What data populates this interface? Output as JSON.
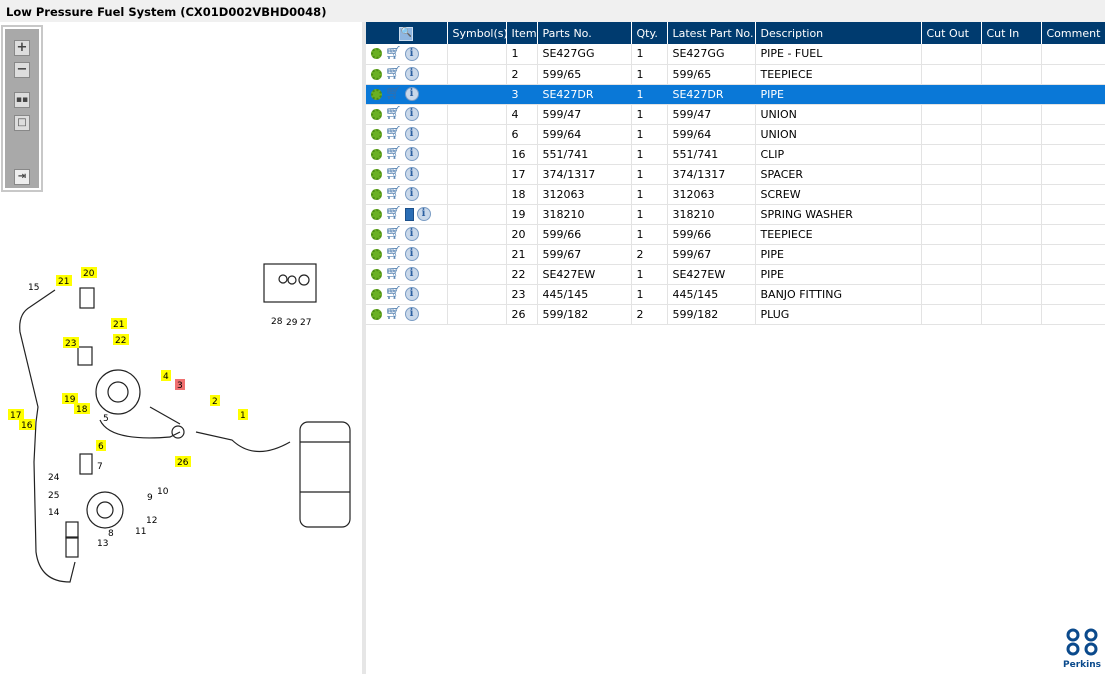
{
  "title": "Low Pressure Fuel System (CX01D002VBHD0048)",
  "toolbar": [
    "zoom-in",
    "zoom-out",
    "fit-all",
    "actual-size",
    "toggle-panel"
  ],
  "table": {
    "headers": [
      "",
      "Symbol(s)",
      "Item",
      "Parts No.",
      "Qty.",
      "Latest Part No.",
      "Description",
      "Cut Out",
      "Cut In",
      "Comment"
    ],
    "rows": [
      {
        "item": "1",
        "part": "SE427GG",
        "qty": "1",
        "latest": "SE427GG",
        "desc": "PIPE - FUEL"
      },
      {
        "item": "2",
        "part": "599/65",
        "qty": "1",
        "latest": "599/65",
        "desc": "TEEPIECE"
      },
      {
        "item": "3",
        "part": "SE427DR",
        "qty": "1",
        "latest": "SE427DR",
        "desc": "PIPE",
        "selected": true
      },
      {
        "item": "4",
        "part": "599/47",
        "qty": "1",
        "latest": "599/47",
        "desc": "UNION"
      },
      {
        "item": "6",
        "part": "599/64",
        "qty": "1",
        "latest": "599/64",
        "desc": "UNION"
      },
      {
        "item": "16",
        "part": "551/741",
        "qty": "1",
        "latest": "551/741",
        "desc": "CLIP"
      },
      {
        "item": "17",
        "part": "374/1317",
        "qty": "1",
        "latest": "374/1317",
        "desc": "SPACER"
      },
      {
        "item": "18",
        "part": "312063",
        "qty": "1",
        "latest": "312063",
        "desc": "SCREW"
      },
      {
        "item": "19",
        "part": "318210",
        "qty": "1",
        "latest": "318210",
        "desc": "SPRING WASHER",
        "book": true
      },
      {
        "item": "20",
        "part": "599/66",
        "qty": "1",
        "latest": "599/66",
        "desc": "TEEPIECE"
      },
      {
        "item": "21",
        "part": "599/67",
        "qty": "2",
        "latest": "599/67",
        "desc": "PIPE"
      },
      {
        "item": "22",
        "part": "SE427EW",
        "qty": "1",
        "latest": "SE427EW",
        "desc": "PIPE"
      },
      {
        "item": "23",
        "part": "445/145",
        "qty": "1",
        "latest": "445/145",
        "desc": "BANJO FITTING"
      },
      {
        "item": "26",
        "part": "599/182",
        "qty": "2",
        "latest": "599/182",
        "desc": "PLUG"
      }
    ]
  },
  "diagram_labels": [
    {
      "t": "15",
      "h": ""
    },
    {
      "t": "21",
      "h": "y"
    },
    {
      "t": "20",
      "h": "y"
    },
    {
      "t": "21",
      "h": "y"
    },
    {
      "t": "22",
      "h": "y"
    },
    {
      "t": "23",
      "h": "y"
    },
    {
      "t": "4",
      "h": "y"
    },
    {
      "t": "3",
      "h": "r"
    },
    {
      "t": "2",
      "h": "y"
    },
    {
      "t": "1",
      "h": "y"
    },
    {
      "t": "19",
      "h": "y"
    },
    {
      "t": "18",
      "h": "y"
    },
    {
      "t": "17",
      "h": "y"
    },
    {
      "t": "16",
      "h": "y"
    },
    {
      "t": "5",
      "h": ""
    },
    {
      "t": "6",
      "h": "y"
    },
    {
      "t": "26",
      "h": "y"
    },
    {
      "t": "24",
      "h": ""
    },
    {
      "t": "7",
      "h": ""
    },
    {
      "t": "25",
      "h": ""
    },
    {
      "t": "9",
      "h": ""
    },
    {
      "t": "10",
      "h": ""
    },
    {
      "t": "14",
      "h": ""
    },
    {
      "t": "12",
      "h": ""
    },
    {
      "t": "11",
      "h": ""
    },
    {
      "t": "8",
      "h": ""
    },
    {
      "t": "13",
      "h": ""
    },
    {
      "t": "28",
      "h": ""
    },
    {
      "t": "29",
      "h": ""
    },
    {
      "t": "27",
      "h": ""
    }
  ],
  "logo": "Perkins",
  "colors": {
    "header": "#003b6f",
    "selected": "#0a78d7",
    "highlight": "#ffff00",
    "current": "#f07070"
  }
}
